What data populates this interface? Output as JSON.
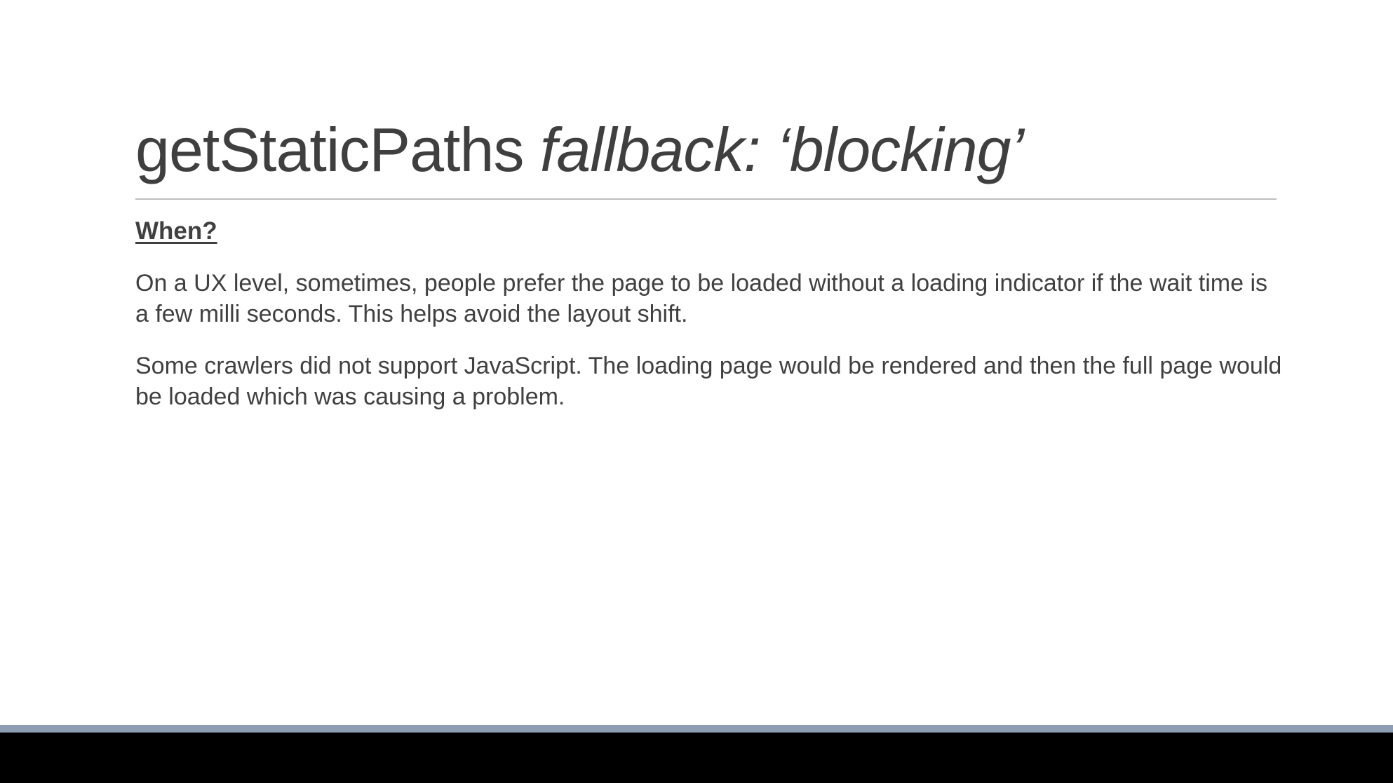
{
  "slide": {
    "title": {
      "plain": "getStaticPaths ",
      "italic": "fallback: ‘blocking’"
    },
    "heading": "When?",
    "paragraphs": [
      "On a UX level, sometimes, people prefer the page to be loaded without a loading indicator if the wait time is a few milli seconds. This helps avoid the layout shift.",
      "Some crawlers did not support JavaScript. The loading page would be rendered and then the full page would be loaded which was causing a problem."
    ]
  },
  "colors": {
    "text": "#404040",
    "rule": "#bfbfbf",
    "footer_bar": "#8d9db3",
    "background": "#ffffff"
  }
}
